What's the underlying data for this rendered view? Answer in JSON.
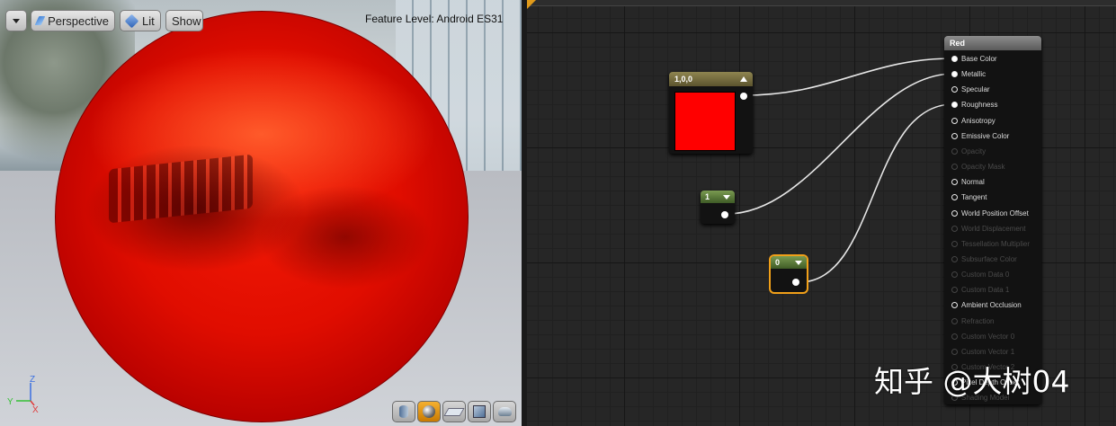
{
  "viewport": {
    "view_mode_label": "Perspective",
    "lighting_label": "Lit",
    "show_label": "Show",
    "feature_level_label": "Feature Level:",
    "feature_level_value": "Android ES31",
    "axis": {
      "z": "Z",
      "y": "Y",
      "x": "X"
    },
    "preview_tools": [
      "cylinder-icon",
      "sphere-icon",
      "plane-icon",
      "cube-icon",
      "custom-mesh-icon"
    ],
    "active_preview": "sphere-icon"
  },
  "graph": {
    "color_node": {
      "title": "1,0,0",
      "swatch_color": "#ff0000"
    },
    "metallic_const": {
      "value": "1"
    },
    "roughness_const": {
      "value": "0"
    },
    "material_node": {
      "title": "Red",
      "pins": [
        {
          "label": "Base Color",
          "enabled": true,
          "connected": true
        },
        {
          "label": "Metallic",
          "enabled": true,
          "connected": true
        },
        {
          "label": "Specular",
          "enabled": true,
          "connected": false
        },
        {
          "label": "Roughness",
          "enabled": true,
          "connected": true
        },
        {
          "label": "Anisotropy",
          "enabled": true,
          "connected": false
        },
        {
          "label": "Emissive Color",
          "enabled": true,
          "connected": false
        },
        {
          "label": "Opacity",
          "enabled": false,
          "connected": false
        },
        {
          "label": "Opacity Mask",
          "enabled": false,
          "connected": false
        },
        {
          "label": "Normal",
          "enabled": true,
          "connected": false
        },
        {
          "label": "Tangent",
          "enabled": true,
          "connected": false
        },
        {
          "label": "World Position Offset",
          "enabled": true,
          "connected": false
        },
        {
          "label": "World Displacement",
          "enabled": false,
          "connected": false
        },
        {
          "label": "Tessellation Multiplier",
          "enabled": false,
          "connected": false
        },
        {
          "label": "Subsurface Color",
          "enabled": false,
          "connected": false
        },
        {
          "label": "Custom Data 0",
          "enabled": false,
          "connected": false
        },
        {
          "label": "Custom Data 1",
          "enabled": false,
          "connected": false
        },
        {
          "label": "Ambient Occlusion",
          "enabled": true,
          "connected": false
        },
        {
          "label": "Refraction",
          "enabled": false,
          "connected": false
        },
        {
          "label": "Custom Vector 0",
          "enabled": false,
          "connected": false
        },
        {
          "label": "Custom Vector 1",
          "enabled": false,
          "connected": false
        },
        {
          "label": "Custom Vector 2",
          "enabled": false,
          "connected": false
        },
        {
          "label": "Pixel Depth Offset",
          "enabled": true,
          "connected": false
        },
        {
          "label": "Shading Model",
          "enabled": false,
          "connected": false
        }
      ]
    }
  },
  "watermark": "知乎 @大树04"
}
